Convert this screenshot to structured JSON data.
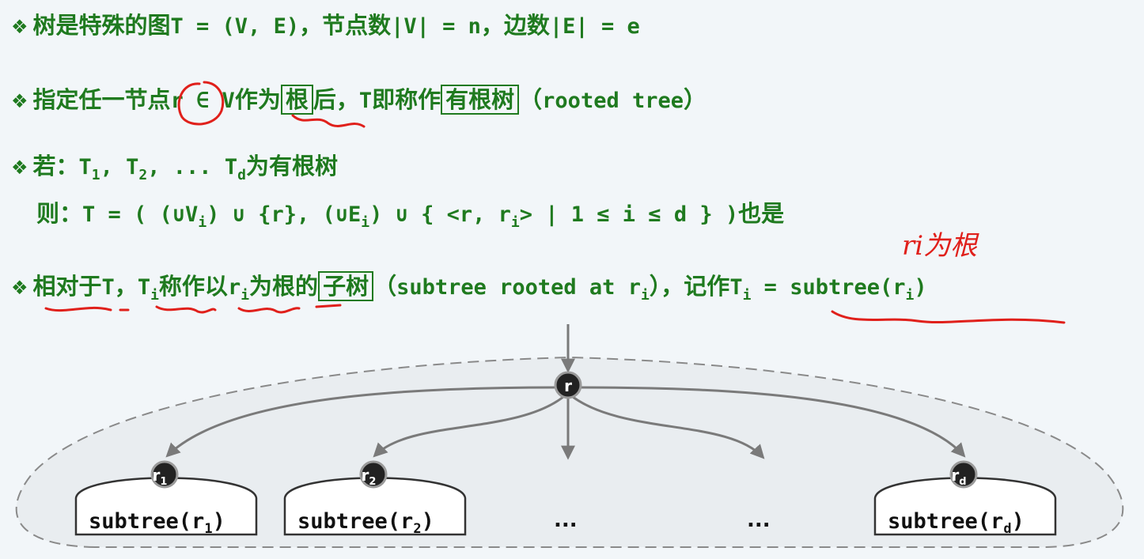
{
  "line1": {
    "text_a": "树是特殊的图",
    "text_b": "T = (V, E)",
    "text_c": "，节点数",
    "text_d": "|V| = n",
    "text_e": "，边数",
    "text_f": "|E| = e"
  },
  "line2": {
    "text_a": "指定任一节点",
    "text_b": "r ∈ V",
    "text_c": "作为",
    "box1": "根",
    "text_d": "后，",
    "text_e": "T",
    "text_f": "即称作",
    "box2": "有根树",
    "text_g": "（",
    "text_h": "rooted tree",
    "text_i": "）"
  },
  "line3": {
    "text_a": "若：",
    "t1": "T",
    "s1": "1",
    "t2": "T",
    "s2": "2",
    "dots": "...",
    "td": "T",
    "sd": "d",
    "text_b": "为有根树"
  },
  "line4": {
    "text_a": "则：",
    "formula": "T = ( (∪V",
    "f_sub1": "i",
    "formula2": ") ∪ {r}, (∪E",
    "f_sub2": "i",
    "formula3": ") ∪ { <r, r",
    "f_sub3": "i",
    "formula4": "> | 1 ≤ i ≤ d } )",
    "text_b": "也是"
  },
  "handwriting": {
    "note": "ri为根"
  },
  "line5": {
    "text_a": "相对于",
    "t": "T",
    "comma": "，",
    "ti": "T",
    "ti_sub": "i",
    "text_b": "称作以",
    "ri": "r",
    "ri_sub": "i",
    "text_c": "为根的",
    "box": "子树",
    "text_d": "（",
    "eng": "subtree rooted at r",
    "eng_sub": "i",
    "text_e": "），记作",
    "ti2": "T",
    "ti2_sub": "i",
    "eq": " = subtree(r",
    "eq_sub": "i",
    "eq_end": ")"
  },
  "diagram": {
    "root_label": "r",
    "nodes": [
      {
        "label": "r",
        "sub": "1",
        "subtree": "subtree(r",
        "subtree_sub": "1"
      },
      {
        "label": "r",
        "sub": "2",
        "subtree": "subtree(r",
        "subtree_sub": "2"
      },
      {
        "label": "r",
        "sub": "d",
        "subtree": "subtree(r",
        "subtree_sub": "d"
      }
    ],
    "ellipsis1": "...",
    "ellipsis2": "...",
    "colors": {
      "node": "#222222",
      "edge": "#7a7a7a",
      "text": "#111111",
      "annotation": "#e0201b"
    }
  }
}
